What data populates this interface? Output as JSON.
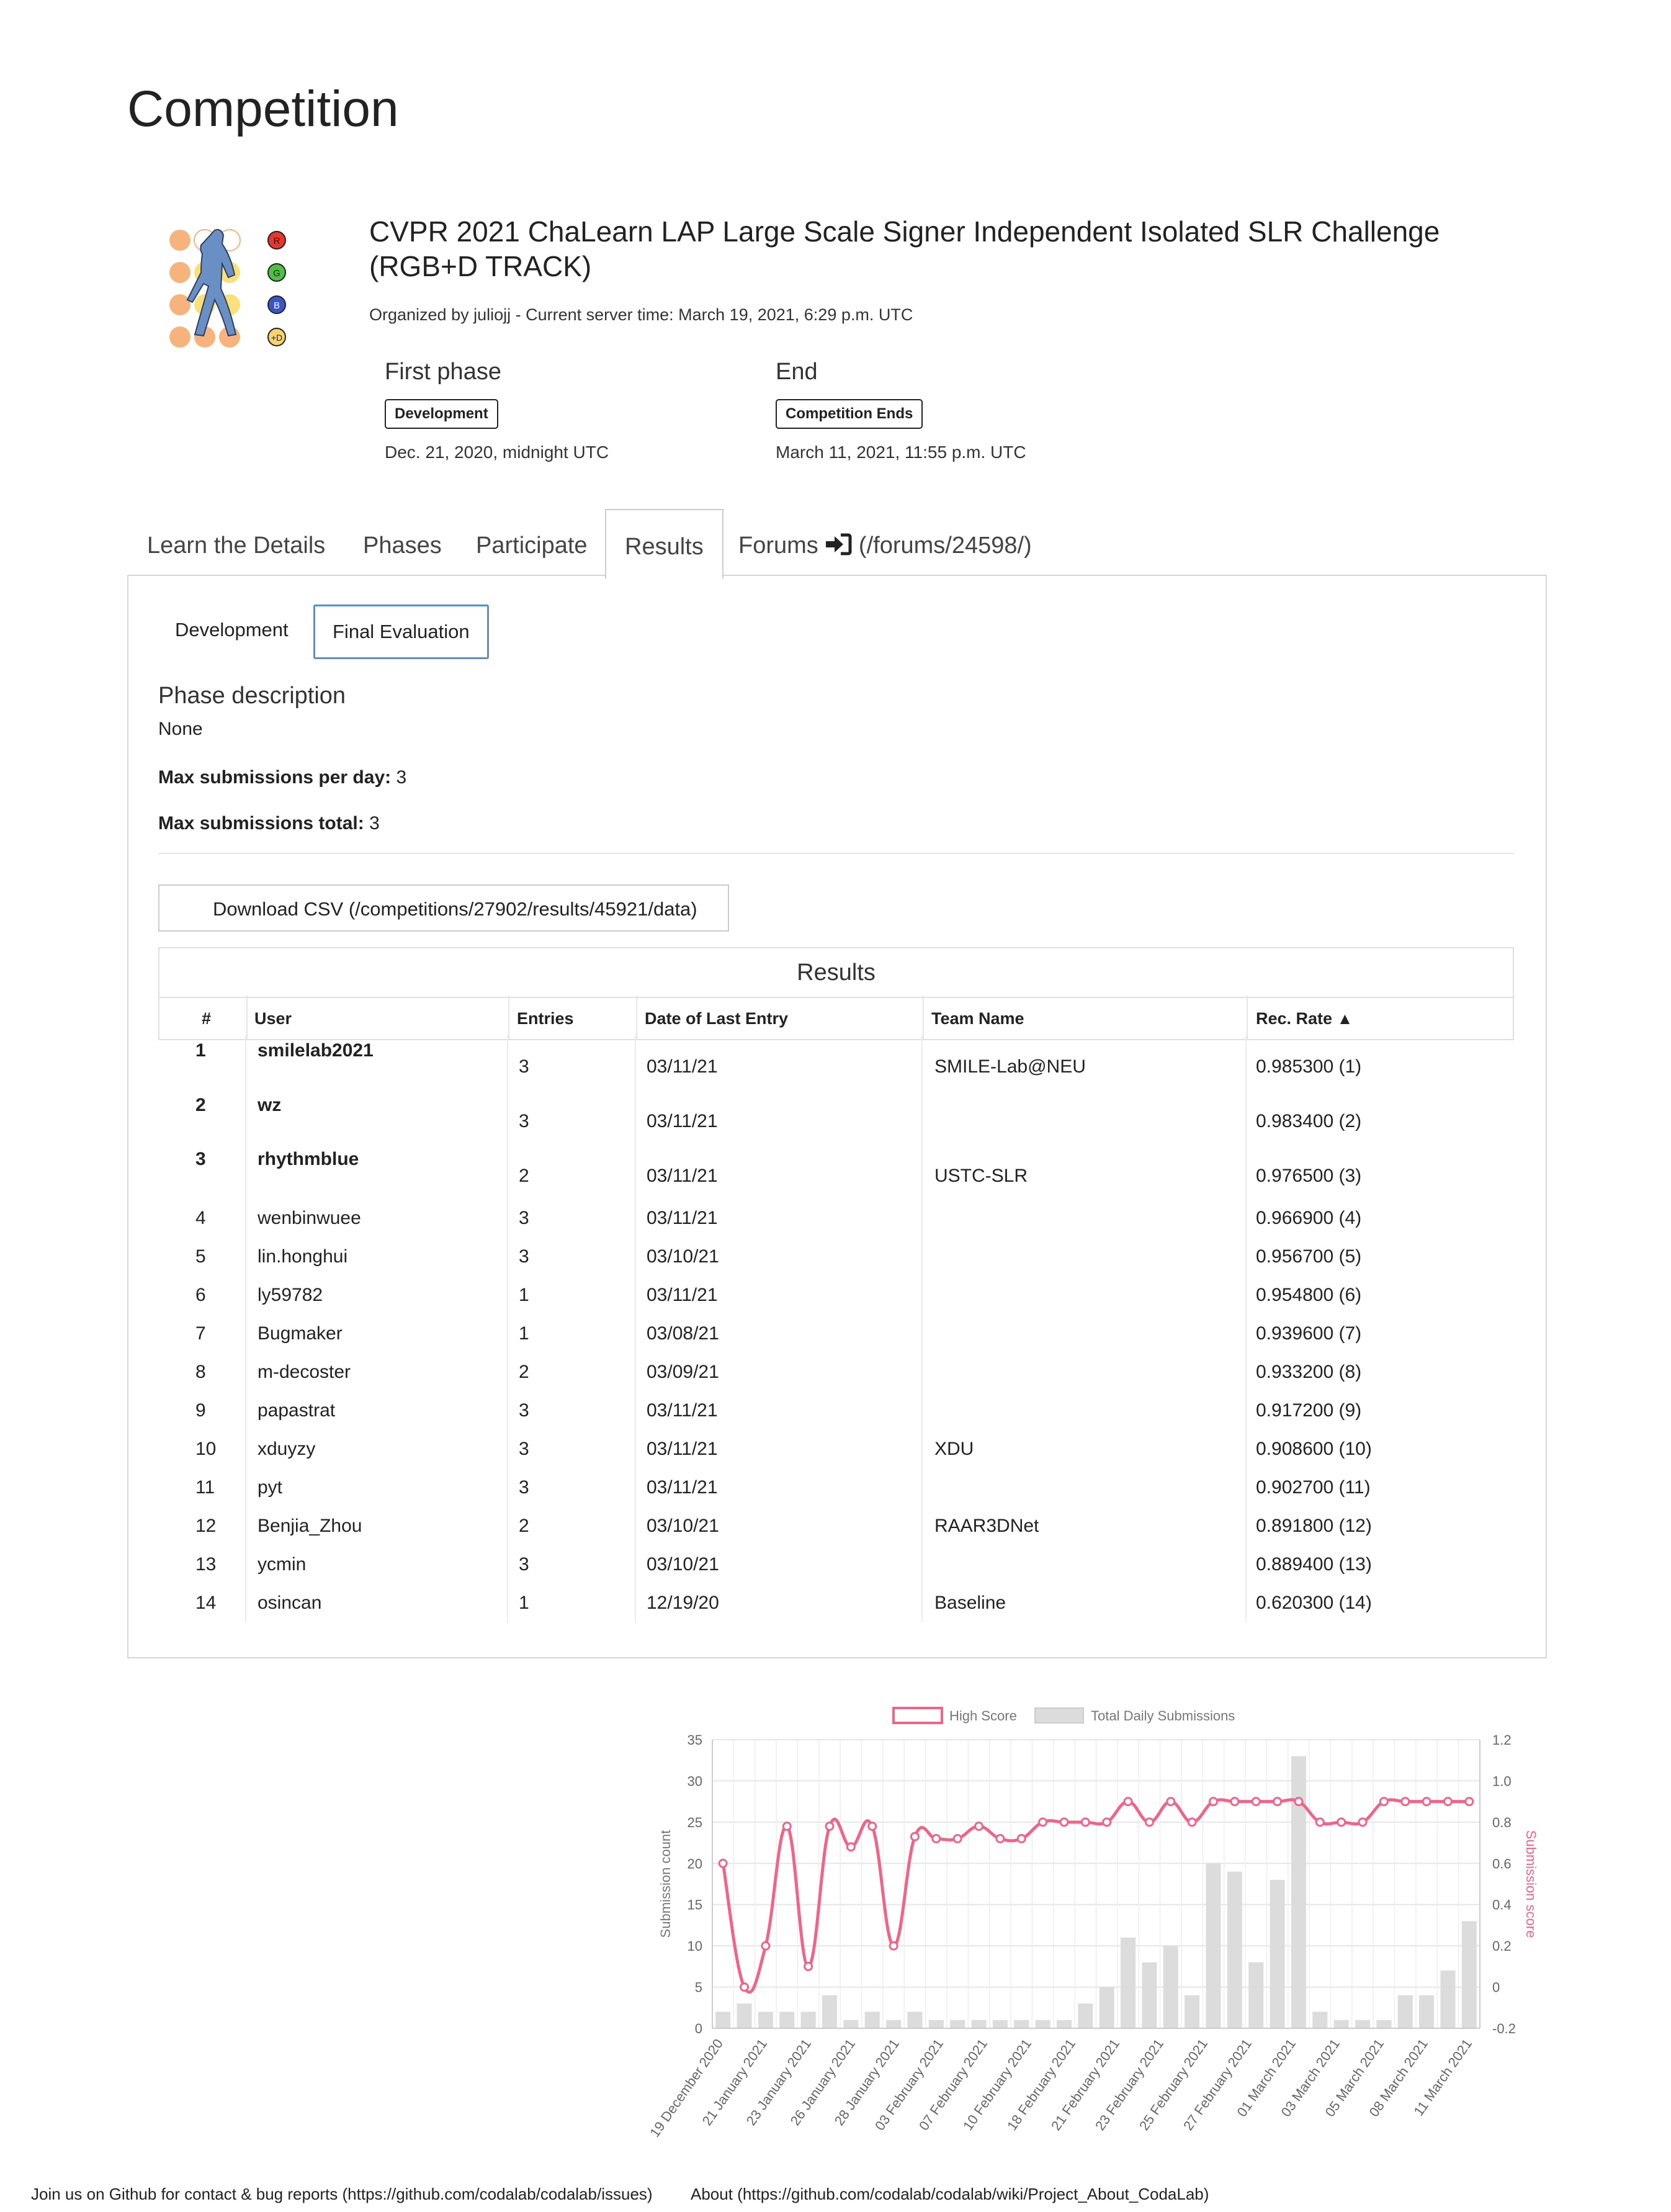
{
  "page": {
    "title": "Competition"
  },
  "competition": {
    "title": "CVPR 2021 ChaLearn LAP Large Scale Signer Independent Isolated SLR Challenge (RGB+D TRACK)",
    "organized_line": "Organized by juliojj - Current server time: March 19, 2021, 6:29 p.m. UTC",
    "logo_letters": [
      "R",
      "G",
      "B",
      "+D"
    ],
    "first_phase": {
      "label": "First phase",
      "badge": "Development",
      "date": "Dec. 21, 2020, midnight UTC"
    },
    "end": {
      "label": "End",
      "badge": "Competition Ends",
      "date": "March 11, 2021, 11:55 p.m. UTC"
    }
  },
  "tabs": {
    "learn": "Learn the Details",
    "phases": "Phases",
    "participate": "Participate",
    "results": "Results",
    "forums": "Forums",
    "forums_link": "(/forums/24598/)"
  },
  "subtabs": {
    "development": "Development",
    "final": "Final Evaluation"
  },
  "phase": {
    "desc_title": "Phase description",
    "desc": "None",
    "max_day_label": "Max submissions per day:",
    "max_day": "3",
    "max_total_label": "Max submissions total:",
    "max_total": "3"
  },
  "download_label": "Download CSV (/competitions/27902/results/45921/data)",
  "results": {
    "title": "Results",
    "headers": {
      "rank": "#",
      "user": "User",
      "entries": "Entries",
      "date": "Date of Last Entry",
      "team": "Team Name",
      "score": "Rec. Rate"
    },
    "rows": [
      {
        "rank": "1",
        "user": "smilelab2021",
        "entries": "3",
        "date": "03/11/21",
        "team": "SMILE-Lab@NEU",
        "score": "0.985300 (1)"
      },
      {
        "rank": "2",
        "user": "wz",
        "entries": "3",
        "date": "03/11/21",
        "team": "",
        "score": "0.983400 (2)"
      },
      {
        "rank": "3",
        "user": "rhythmblue",
        "entries": "2",
        "date": "03/11/21",
        "team": "USTC-SLR",
        "score": "0.976500 (3)"
      },
      {
        "rank": "4",
        "user": "wenbinwuee",
        "entries": "3",
        "date": "03/11/21",
        "team": "",
        "score": "0.966900 (4)"
      },
      {
        "rank": "5",
        "user": "lin.honghui",
        "entries": "3",
        "date": "03/10/21",
        "team": "",
        "score": "0.956700 (5)"
      },
      {
        "rank": "6",
        "user": "ly59782",
        "entries": "1",
        "date": "03/11/21",
        "team": "",
        "score": "0.954800 (6)"
      },
      {
        "rank": "7",
        "user": "Bugmaker",
        "entries": "1",
        "date": "03/08/21",
        "team": "",
        "score": "0.939600 (7)"
      },
      {
        "rank": "8",
        "user": "m-decoster",
        "entries": "2",
        "date": "03/09/21",
        "team": "",
        "score": "0.933200 (8)"
      },
      {
        "rank": "9",
        "user": "papastrat",
        "entries": "3",
        "date": "03/11/21",
        "team": "",
        "score": "0.917200 (9)"
      },
      {
        "rank": "10",
        "user": "xduyzy",
        "entries": "3",
        "date": "03/11/21",
        "team": "XDU",
        "score": "0.908600 (10)"
      },
      {
        "rank": "11",
        "user": "pyt",
        "entries": "3",
        "date": "03/11/21",
        "team": "",
        "score": "0.902700 (11)"
      },
      {
        "rank": "12",
        "user": "Benjia_Zhou",
        "entries": "2",
        "date": "03/10/21",
        "team": "RAAR3DNet",
        "score": "0.891800 (12)"
      },
      {
        "rank": "13",
        "user": "ycmin",
        "entries": "3",
        "date": "03/10/21",
        "team": "",
        "score": "0.889400 (13)"
      },
      {
        "rank": "14",
        "user": "osincan",
        "entries": "1",
        "date": "12/19/20",
        "team": "Baseline",
        "score": "0.620300 (14)"
      }
    ]
  },
  "chart_data": {
    "type": "bar+line",
    "legend": [
      "High Score",
      "Total Daily Submissions"
    ],
    "legend_position": "top",
    "ylabel_left": "Submission count",
    "ylabel_right": "Submission score",
    "ylim_left": [
      0,
      35
    ],
    "yticks_left": [
      "0",
      "5",
      "10",
      "15",
      "20",
      "25",
      "30",
      "35"
    ],
    "ylim_right": [
      -0.2,
      1.2
    ],
    "yticks_right": [
      "-0.2",
      "0",
      "0.2",
      "0.4",
      "0.6",
      "0.8",
      "1.0",
      "1.2"
    ],
    "x_tick_labels": [
      "19 December 2020",
      "21 January 2021",
      "23 January 2021",
      "26 January 2021",
      "28 January 2021",
      "03 February 2021",
      "07 February 2021",
      "10 February 2021",
      "18 February 2021",
      "21 February 2021",
      "23 February 2021",
      "25 February 2021",
      "27 February 2021",
      "01 March 2021",
      "03 March 2021",
      "05 March 2021",
      "08 March 2021",
      "11 March 2021"
    ],
    "submissions": [
      2,
      3,
      2,
      2,
      2,
      4,
      1,
      2,
      1,
      2,
      1,
      1,
      1,
      1,
      1,
      1,
      1,
      3,
      5,
      11,
      8,
      10,
      4,
      20,
      19,
      8,
      18,
      33,
      2,
      1,
      1,
      1,
      4,
      4,
      7,
      13
    ],
    "high_score": [
      0.6,
      0.0,
      0.2,
      0.78,
      0.1,
      0.78,
      0.68,
      0.78,
      0.2,
      0.73,
      0.72,
      0.72,
      0.78,
      0.72,
      0.72,
      0.8,
      0.8,
      0.8,
      0.8,
      0.9,
      0.8,
      0.9,
      0.8,
      0.9,
      0.9,
      0.9,
      0.9,
      0.9,
      0.8,
      0.8,
      0.8,
      0.9,
      0.9,
      0.9,
      0.9,
      0.9
    ],
    "colors": {
      "line": "#f0648a",
      "bar": "#dcdcdc"
    }
  },
  "footer": {
    "github": "Join us on Github for contact & bug reports (https://github.com/codalab/codalab/issues)",
    "about": "About (https://github.com/codalab/codalab/wiki/Project_About_CodaLab)"
  }
}
